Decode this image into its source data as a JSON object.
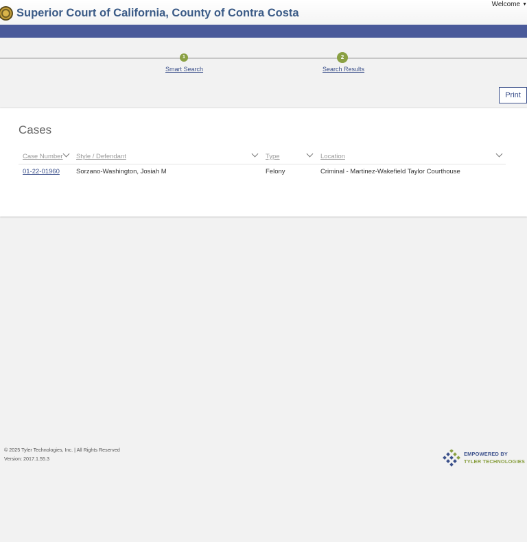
{
  "header": {
    "title": "Superior Court of California, County of Contra Costa",
    "welcome_label": "Welcome"
  },
  "steps": [
    {
      "number": "1",
      "label": "Smart Search"
    },
    {
      "number": "2",
      "label": "Search Results"
    }
  ],
  "toolbar": {
    "print_label": "Print"
  },
  "cases": {
    "title": "Cases",
    "columns": [
      "Case Number",
      "Style / Defendant",
      "Type",
      "Location"
    ],
    "rows": [
      {
        "case_number": "01-22-01960",
        "style_defendant": "Sorzano-Washington, Josiah M",
        "type": "Felony",
        "location": "Criminal - Martinez-Wakefield Taylor Courthouse"
      }
    ]
  },
  "footer": {
    "copyright": "© 2025 Tyler Technologies, Inc. | All Rights Reserved",
    "version": "Version: 2017.1.55.3",
    "logo_line1": "EMPOWERED BY",
    "logo_line2": "TYLER TECHNOLOGIES"
  },
  "colors": {
    "nav_bar": "#4a5a9a",
    "title_blue": "#3a5a86",
    "step_green": "#8aa043",
    "link_blue": "#3a4f8a"
  }
}
